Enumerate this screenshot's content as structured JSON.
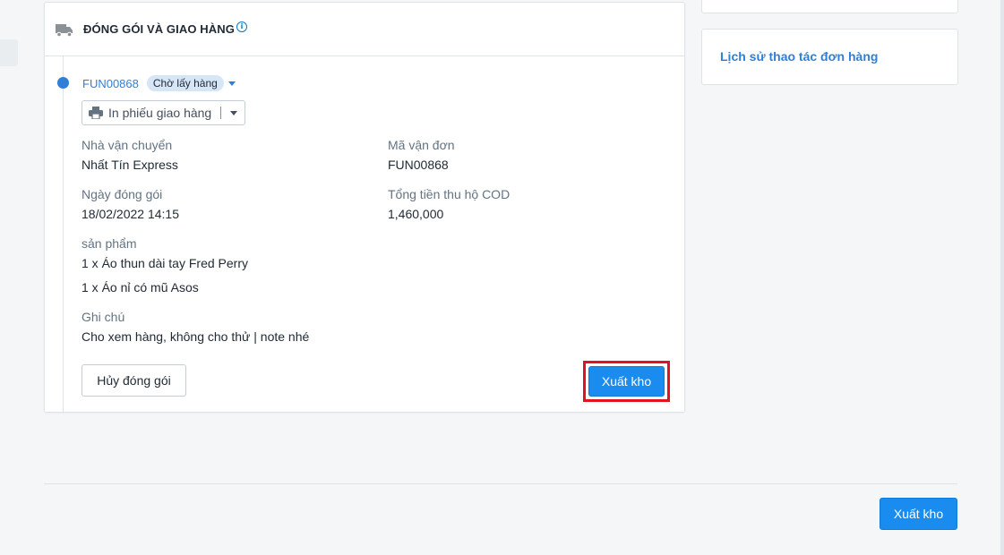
{
  "fulfillment_card": {
    "title": "ĐÓNG GÓI VÀ GIAO HÀNG",
    "title_icon": "truck-icon",
    "info_icon": "info-icon",
    "info_glyph": "i",
    "fulfillment_code": "FUN00868",
    "status": "Chờ lấy hàng",
    "print_button_label": "In phiếu giao hàng",
    "fields": {
      "carrier_label": "Nhà vận chuyển",
      "carrier_value": "Nhất Tín Express",
      "tracking_label": "Mã vận đơn",
      "tracking_value": "FUN00868",
      "packed_date_label": "Ngày đóng gói",
      "packed_date_value": "18/02/2022 14:15",
      "cod_label": "Tổng tiền thu hộ COD",
      "cod_value": "1,460,000",
      "products_label": "sản phẩm",
      "products": [
        "1 x Áo thun dài tay Fred Perry",
        "1 x Áo nỉ có mũ Asos"
      ],
      "note_label": "Ghi chú",
      "note_value": "Cho xem hàng, không cho thử | note nhé"
    },
    "cancel_button_label": "Hủy đóng gói",
    "export_button_label": "Xuất kho"
  },
  "history_card": {
    "link_label": "Lịch sử thao tác đơn hàng"
  },
  "footer": {
    "export_button_label": "Xuất kho"
  },
  "colors": {
    "accent": "#2f7fd8",
    "primary_button": "#1a8cf0",
    "highlight": "#e0141e",
    "badge_bg": "#d6e6f7"
  }
}
